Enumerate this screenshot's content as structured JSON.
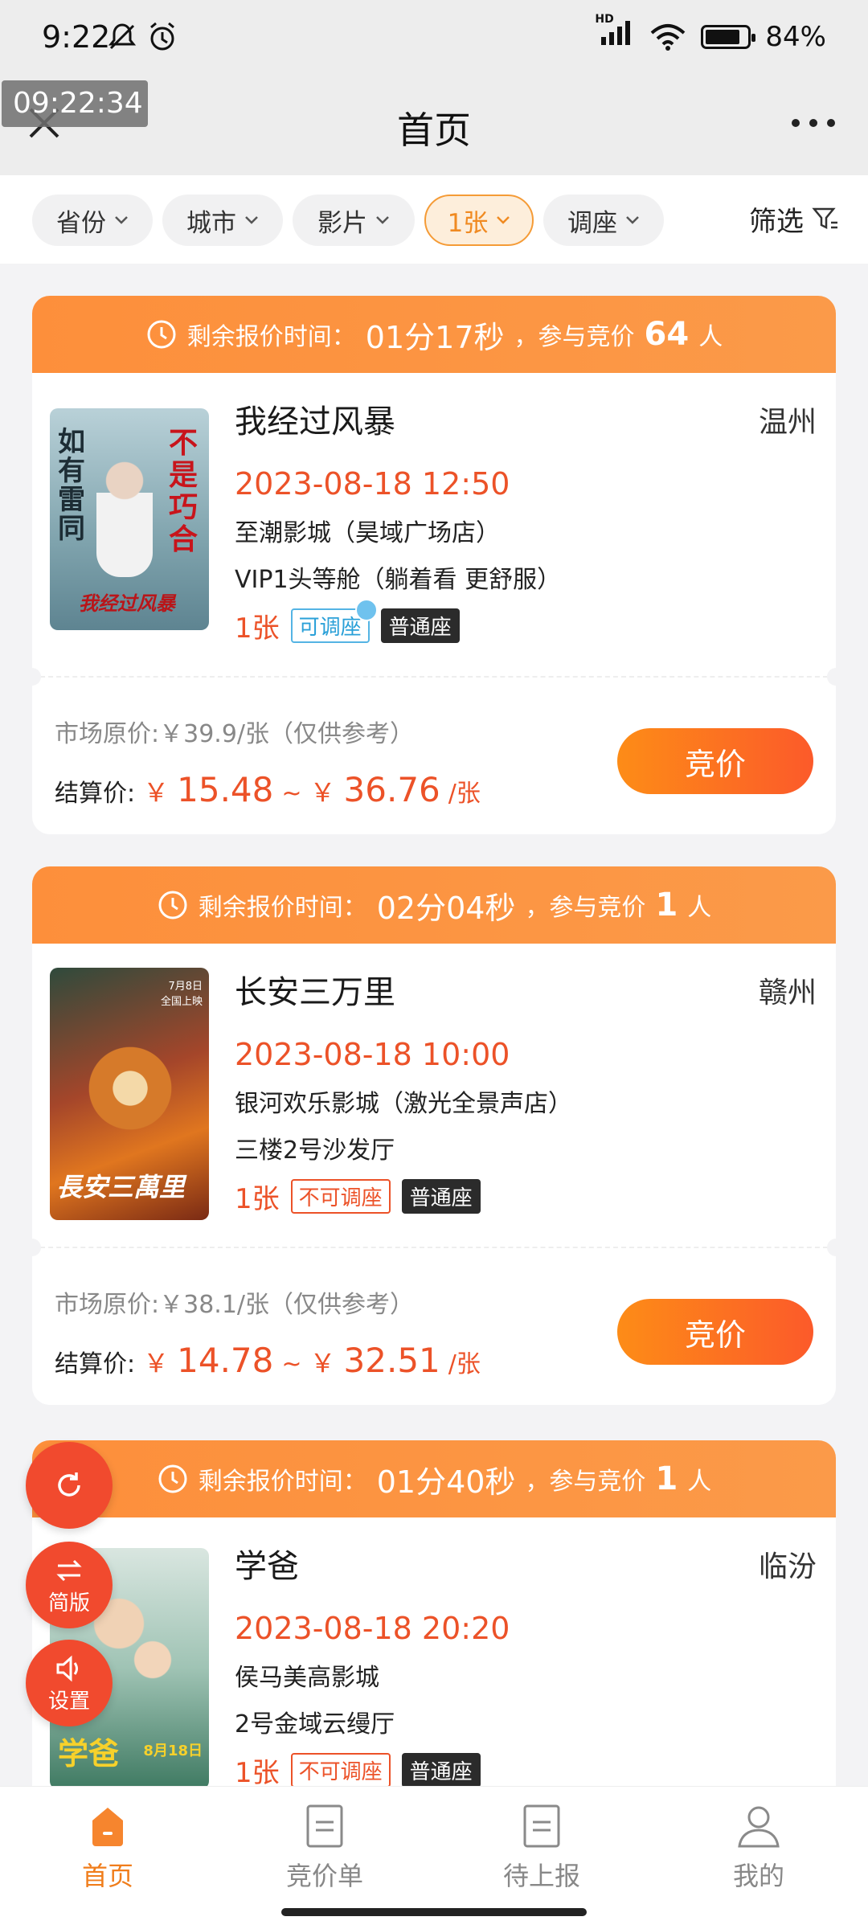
{
  "status_bar": {
    "time": "9:22",
    "signal_label": "HD",
    "battery": "84%",
    "battery_level": 0.84
  },
  "overlay": {
    "timer": "09:22:34"
  },
  "header": {
    "title": "首页",
    "close_icon": "close-icon",
    "more_icon": "more-icon"
  },
  "filters": {
    "chips": [
      {
        "label": "省份"
      },
      {
        "label": "城市"
      },
      {
        "label": "影片"
      },
      {
        "label": "1张",
        "active": true
      },
      {
        "label": "调座"
      }
    ],
    "filter_label": "筛选"
  },
  "cards": [
    {
      "timer_prefix": "剩余报价时间：",
      "timer": "01分17秒",
      "bidders_prefix": "，参与竞价",
      "bidders": "64",
      "bidders_suffix": "人",
      "title": "我经过风暴",
      "city": "温州",
      "showtime": "2023-08-18 12:50",
      "cinema": "至潮影城（昊域广场店）",
      "hall": "VIP1头等舱（躺着看 更舒服）",
      "qty": "1张",
      "adjust_tag": "可调座",
      "seat_tag": "普通座",
      "market_price": "市场原价:￥39.9/张（仅供参考）",
      "settle_label": "结算价:",
      "currency": "￥",
      "price_low": "15.48",
      "price_sep": "~",
      "price_high": "36.76",
      "price_unit": "/张",
      "bid_label": "竞价",
      "poster_text_1": "如有雷同",
      "poster_text_2": "不是巧合",
      "poster_text_3": "我经过风暴"
    },
    {
      "timer_prefix": "剩余报价时间：",
      "timer": "02分04秒",
      "bidders_prefix": "，参与竞价",
      "bidders": "1",
      "bidders_suffix": "人",
      "title": "长安三万里",
      "city": "赣州",
      "showtime": "2023-08-18 10:00",
      "cinema": "银河欢乐影城（激光全景声店）",
      "hall": "三楼2号沙发厅",
      "qty": "1张",
      "adjust_tag": "不可调座",
      "seat_tag": "普通座",
      "market_price": "市场原价:￥38.1/张（仅供参考）",
      "settle_label": "结算价:",
      "currency": "￥",
      "price_low": "14.78",
      "price_sep": "~",
      "price_high": "32.51",
      "price_unit": "/张",
      "bid_label": "竞价",
      "poster_text_1": "長安三萬里",
      "poster_text_2": "7月8日 全国上映"
    },
    {
      "timer_prefix": "剩余报价时间：",
      "timer": "01分40秒",
      "bidders_prefix": "，参与竞价",
      "bidders": "1",
      "bidders_suffix": "人",
      "title": "学爸",
      "city": "临汾",
      "showtime": "2023-08-18 20:20",
      "cinema": "侯马美高影城",
      "hall": "2号金域云缦厅",
      "qty": "1张",
      "adjust_tag": "不可调座",
      "seat_tag": "普通座",
      "poster_text_1": "学爸",
      "poster_text_2": "8月18日"
    }
  ],
  "floating": {
    "refresh_icon": "refresh-icon",
    "simple_label": "简版",
    "settings_label": "设置"
  },
  "tabbar": [
    {
      "label": "首页",
      "icon": "home-icon",
      "active": true
    },
    {
      "label": "竞价单",
      "icon": "document-icon"
    },
    {
      "label": "待上报",
      "icon": "document-icon"
    },
    {
      "label": "我的",
      "icon": "user-icon"
    }
  ],
  "colors": {
    "accent": "#f07d1b",
    "price": "#ec5228",
    "header_orange": "#fd8f3b"
  }
}
